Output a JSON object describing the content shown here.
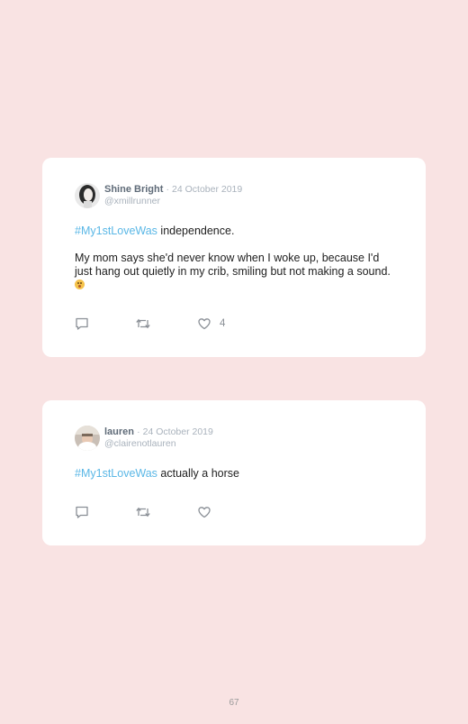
{
  "tweets": [
    {
      "name": "Shine Bright",
      "separator": "·",
      "date": "24 October 2019",
      "handle": "@xmillrunner",
      "hashtag": "#My1stLoveWas",
      "text_after_hashtag": " independence.",
      "paragraph2": "My mom says she'd never know when I woke up, because I'd just hang out quietly in my crib, smiling but not making a sound. ",
      "emoji": "baby-face-emoji",
      "like_count": "4",
      "icons": [
        "reply-icon",
        "retweet-icon",
        "like-icon"
      ]
    },
    {
      "name": "lauren",
      "separator": "·",
      "date": "24 October 2019",
      "handle": "@clairenotlauren",
      "hashtag": "#My1stLoveWas",
      "text_after_hashtag": " actually a horse",
      "icons": [
        "reply-icon",
        "retweet-icon",
        "like-icon"
      ]
    }
  ],
  "page": {
    "number": "67"
  },
  "colors": {
    "background": "#f9e3e3",
    "card": "#ffffff",
    "hashtag": "#5ab7e6",
    "name": "#5f6b78",
    "meta": "#a9b2bc"
  }
}
